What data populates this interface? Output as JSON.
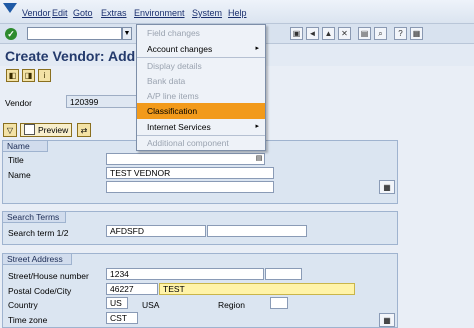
{
  "menubar": {
    "items": [
      "Vendor",
      "Edit",
      "Goto",
      "Extras",
      "Environment",
      "System",
      "Help"
    ]
  },
  "title": "Create Vendor: Addr",
  "vendor": {
    "label": "Vendor",
    "value": "120399"
  },
  "toolbar": {
    "preview_label": "Preview"
  },
  "name_group": {
    "title": "Name",
    "title_label": "Title",
    "name_label": "Name",
    "name_value": "TEST VEDNOR"
  },
  "search_group": {
    "title": "Search Terms",
    "label": "Search term 1/2",
    "term1": "AFDSFD"
  },
  "address_group": {
    "title": "Street Address",
    "street_label": "Street/House number",
    "street_value": "1234",
    "postal_label": "Postal Code/City",
    "postal_value": "46227",
    "city_value": "TEST",
    "country_label": "Country",
    "country_value": "US",
    "country_name": "USA",
    "region_label": "Region",
    "timezone_label": "Time zone",
    "timezone_value": "CST"
  },
  "environment_menu": {
    "items": [
      {
        "label": "Field changes",
        "state": "disabled"
      },
      {
        "label": "Account changes",
        "state": "submenu"
      },
      {
        "label": "Display details",
        "state": "disabled"
      },
      {
        "label": "Bank data",
        "state": "disabled"
      },
      {
        "label": "A/P line items",
        "state": "disabled"
      },
      {
        "label": "Classification",
        "state": "highlighted"
      },
      {
        "label": "Internet Services",
        "state": "submenu"
      },
      {
        "label": "Additional component",
        "state": "disabled"
      }
    ]
  },
  "colors": {
    "highlight": "#f29a1b",
    "required_field": "#fff3a8"
  }
}
